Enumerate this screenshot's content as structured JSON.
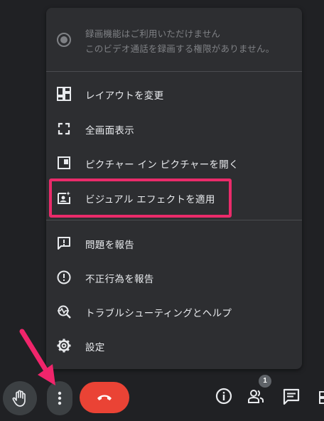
{
  "menu": {
    "recording_notice": {
      "line1": "録画機能はご利用いただけません",
      "line2": "このビデオ通話を録画する権限がありません。",
      "icon": "record-icon"
    },
    "items": [
      {
        "label": "レイアウトを変更",
        "icon": "layout-icon"
      },
      {
        "label": "全画面表示",
        "icon": "fullscreen-icon"
      },
      {
        "label": "ピクチャー イン ピクチャーを開く",
        "icon": "picture-in-picture-icon"
      },
      {
        "label": "ビジュアル エフェクトを適用",
        "icon": "visual-effects-icon"
      },
      {
        "label": "問題を報告",
        "icon": "feedback-icon"
      },
      {
        "label": "不正行為を報告",
        "icon": "report-icon"
      },
      {
        "label": "トラブルシューティングとヘルプ",
        "icon": "troubleshoot-icon"
      },
      {
        "label": "設定",
        "icon": "settings-icon"
      }
    ]
  },
  "toolbar": {
    "people_badge_count": "1",
    "highlight_color": "#ea2b6a",
    "end_call_color": "#ea4335"
  }
}
